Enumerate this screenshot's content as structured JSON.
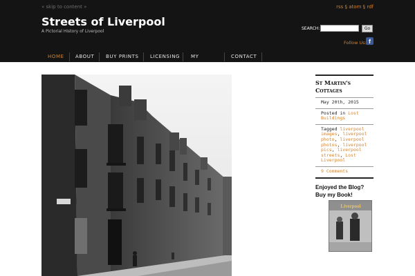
{
  "header": {
    "skip_link": "« skip to content »",
    "feeds": "rss § atom § rdf",
    "site_title": "Streets of Liverpool",
    "tagline": "A Pictorial History of Liverpool",
    "search_label": "SEARCH:",
    "search_value": "",
    "search_button": "Go",
    "follow_label": "Follow Us:",
    "facebook_glyph": "f"
  },
  "nav": {
    "items": [
      {
        "label": "HOME",
        "active": true
      },
      {
        "label": "ABOUT",
        "active": false
      },
      {
        "label": "BUY PRINTS",
        "active": false
      },
      {
        "label": "LICENSING",
        "active": false
      },
      {
        "label": "MY BOOKS",
        "active": false
      },
      {
        "label": "CONTACT",
        "active": false
      }
    ]
  },
  "post": {
    "title": "St Martin's Cottages",
    "date": "May 20th, 2015",
    "posted_in_label": "Posted in",
    "category": "Lost Buildings",
    "tagged_label": "Tagged",
    "tags": [
      "liverpool images",
      "liverpool photo",
      "liverpool photos",
      "liverpool pics",
      "liverpool streets",
      "Lost Liverpool"
    ],
    "comments": "9 Comments"
  },
  "sidebar": {
    "buy_book_title": "Enjoyed the Blog? Buy my Book!",
    "book_cover_title": "Liverpool"
  },
  "colors": {
    "accent": "#d2822f",
    "header_bg": "#141414"
  }
}
